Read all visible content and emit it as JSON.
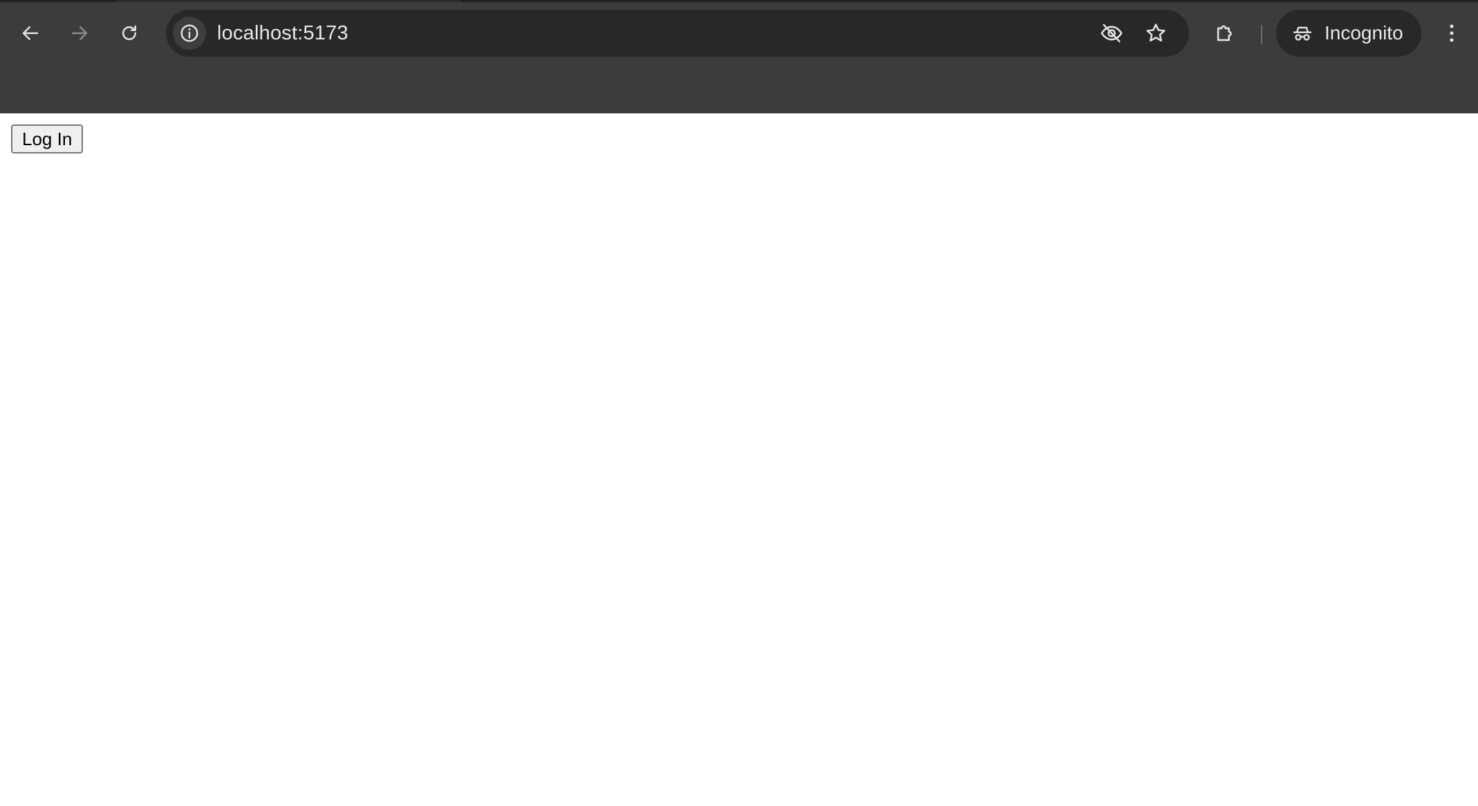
{
  "browser": {
    "url": "localhost:5173",
    "incognito_label": "Incognito",
    "icons": {
      "back": "arrow-left-icon",
      "forward": "arrow-right-icon",
      "reload": "reload-icon",
      "site_info": "info-icon",
      "tracking_protection": "eye-off-icon",
      "bookmark": "star-icon",
      "extensions": "puzzle-icon",
      "incognito": "incognito-icon",
      "menu": "kebab-menu-icon"
    },
    "colors": {
      "chrome_bg": "#3c3c3c",
      "omnibox_bg": "#282828",
      "text": "#e8e8e8",
      "icon": "#e3e3e3",
      "icon_disabled": "#8a8a8a"
    },
    "forward_enabled": false
  },
  "page": {
    "login_button_label": "Log In"
  }
}
